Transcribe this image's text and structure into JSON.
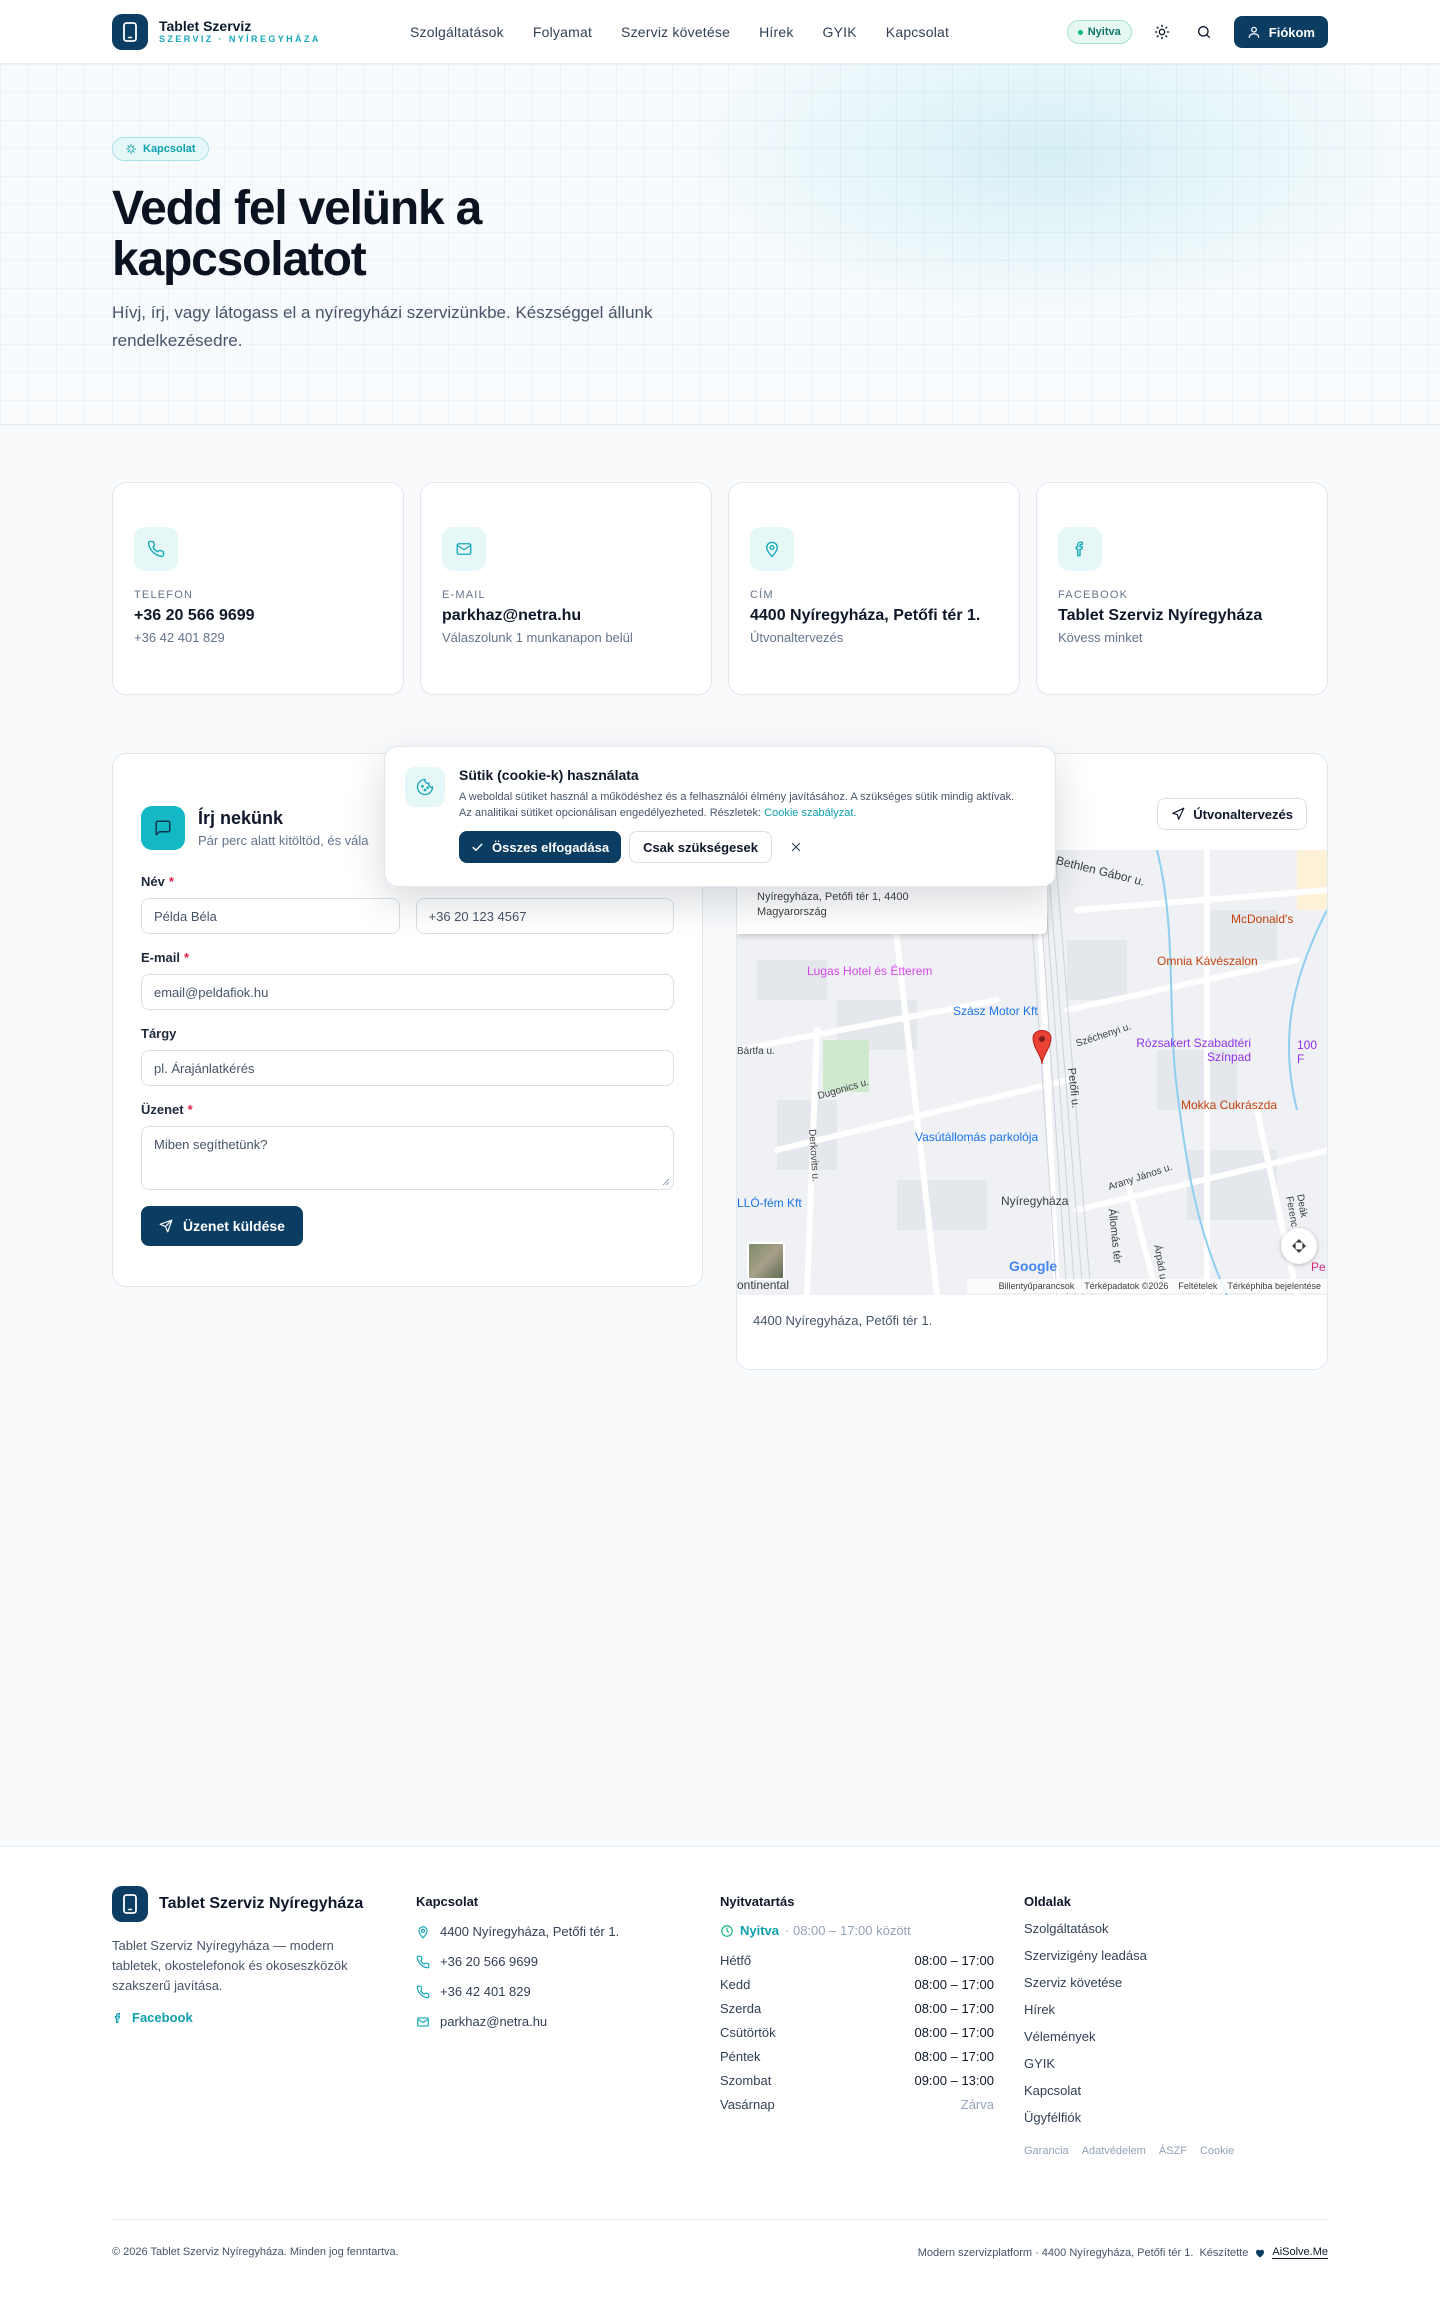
{
  "nav": {
    "brand_title": "Tablet Szerviz",
    "brand_sub": "SZERVIZ · NYÍREGYHÁZA",
    "menu": [
      "Szolgáltatások",
      "Folyamat",
      "Szerviz követése",
      "Hírek",
      "GYIK",
      "Kapcsolat"
    ],
    "status": "Nyitva",
    "account": "Fiókom"
  },
  "hero": {
    "tag": "Kapcsolat",
    "title": "Vedd fel velünk a kapcsolatot",
    "subtitle": "Hívj, írj, vagy látogass el a nyíregyházi szervizünkbe. Készséggel állunk rendelkezésedre."
  },
  "cards": [
    {
      "label": "TELEFON",
      "value": "+36 20 566 9699",
      "sub": "+36 42 401 829",
      "icon": "phone-icon"
    },
    {
      "label": "E-MAIL",
      "value": "parkhaz@netra.hu",
      "sub": "Válaszolunk 1 munkanapon belül",
      "icon": "mail-icon"
    },
    {
      "label": "CÍM",
      "value": "4400 Nyíregyháza, Petőfi tér 1.",
      "sub": "Útvonaltervezés",
      "icon": "map-pin-icon"
    },
    {
      "label": "FACEBOOK",
      "value": "Tablet Szerviz Nyíregyháza",
      "sub": "Kövess minket",
      "icon": "facebook-icon"
    }
  ],
  "form": {
    "title": "Írj nekünk",
    "subtitle": "Pár perc alatt kitöltöd, és vála",
    "name_label": "Név",
    "name_placeholder": "Példa Béla",
    "phone_placeholder": "+36 20 123 4567",
    "email_label": "E-mail",
    "email_placeholder": "email@peldafiok.hu",
    "subject_label": "Tárgy",
    "subject_placeholder": "pl. Árajánlatkérés",
    "message_label": "Üzenet",
    "message_placeholder": "Miben segíthetünk?",
    "submit": "Üzenet küldése"
  },
  "map": {
    "route_button": "Útvonaltervezés",
    "info_address": "Nyíregyháza, Petőfi tér 1, 4400 Magyarország",
    "streets": [
      "Bethlen Gábor u.",
      "Széchenyi u.",
      "Petőfi u.",
      "Bártfa u.",
      "Dugonics u.",
      "Derkovits u.",
      "Arany János u.",
      "Állomás tér",
      "Deák Ferenc út",
      "Árpád u."
    ],
    "pois": [
      "McDonald's",
      "Omnia Kávészalon",
      "Lugas Hotel és Étterem",
      "Szász Motor Kft",
      "Rózsakert Szabadtéri Színpad",
      "100 F",
      "Mokka Cukrászda",
      "Vasútállomás parkolója",
      "Nyíregyháza",
      "LLÓ-fém Kft",
      "ontinental",
      "Pe"
    ],
    "google": "Google",
    "attribution": [
      "Billentyűparancsok",
      "Térképadatok ©2026",
      "Feltételek",
      "Térképhiba bejelentése"
    ],
    "address": "4400 Nyíregyháza, Petőfi tér 1."
  },
  "cookie": {
    "title": "Sütik (cookie-k) használata",
    "text": "A weboldal sütiket használ a működéshez és a felhasználói élmény javításához. A szükséges sütik mindig aktívak. Az analitikai sütiket opcionálisan engedélyezheted. Részletek:",
    "link": "Cookie szabályzat.",
    "accept": "Összes elfogadása",
    "necessary": "Csak szükségesek"
  },
  "footer": {
    "brand": "Tablet Szerviz Nyíregyháza",
    "desc": "Tablet Szerviz Nyíregyháza — modern tabletek, okostelefonok és okoseszközök szakszerű javítása.",
    "facebook": "Facebook",
    "contact_title": "Kapcsolat",
    "contacts": [
      "4400 Nyíregyháza, Petőfi tér 1.",
      "+36 20 566 9699",
      "+36 42 401 829",
      "parkhaz@netra.hu"
    ],
    "hours_title": "Nyitvatartás",
    "status": "Nyitva",
    "status_range": "· 08:00 – 17:00 között",
    "hours": [
      {
        "day": "Hétfő",
        "time": "08:00 – 17:00"
      },
      {
        "day": "Kedd",
        "time": "08:00 – 17:00"
      },
      {
        "day": "Szerda",
        "time": "08:00 – 17:00"
      },
      {
        "day": "Csütörtök",
        "time": "08:00 – 17:00"
      },
      {
        "day": "Péntek",
        "time": "08:00 – 17:00"
      },
      {
        "day": "Szombat",
        "time": "09:00 – 13:00"
      },
      {
        "day": "Vasárnap",
        "time": "Zárva"
      }
    ],
    "pages_title": "Oldalak",
    "pages": [
      "Szolgáltatások",
      "Szervizigény leadása",
      "Szerviz követése",
      "Hírek",
      "Vélemények",
      "GYIK",
      "Kapcsolat",
      "Ügyfélfiók"
    ],
    "legal": [
      "Garancia",
      "Adatvédelem",
      "ÁSZF",
      "Cookie"
    ],
    "copyright": "© 2026 Tablet Szerviz Nyíregyháza. Minden jog fenntartva.",
    "platform": "Modern szervizplatform · 4400 Nyíregyháza, Petőfi tér 1.",
    "made_by": "Készítette",
    "ai": "AiSolve.Me"
  },
  "colors": {
    "primary": "#0b3d63",
    "accent": "#14b8c4",
    "open": "#10b981"
  }
}
